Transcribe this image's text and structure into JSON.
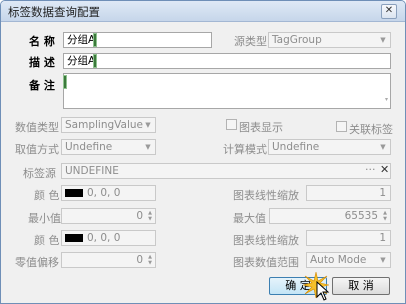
{
  "window": {
    "title": "标签数据查询配置",
    "close_glyph": "✕"
  },
  "form": {
    "name_label": "名 称",
    "name_value": "分组A",
    "source_type_label": "源类型",
    "source_type_value": "TagGroup",
    "desc_label": "描 述",
    "desc_value": "分组A",
    "remark_label": "备 注",
    "remark_value": "",
    "data_type_label": "数值类型",
    "data_type_value": "SamplingValue",
    "chart_display_label": "图表显示",
    "related_tag_label": "关联标签",
    "fetch_mode_label": "取值方式",
    "fetch_mode_value": "Undefine",
    "calc_mode_label": "计算模式",
    "calc_mode_value": "Undefine",
    "tag_source_label": "标签源",
    "tag_source_value": "UNDEFINE",
    "tag_source_more": "···",
    "tag_source_clear": "✕",
    "color1_label": "颜 色",
    "color1_value": "0, 0, 0",
    "chart_line_scale1_label": "图表线性缩放",
    "chart_line_scale1_value": "1",
    "min_label": "最小值",
    "min_value": "0",
    "max_label": "最大值",
    "max_value": "65535",
    "color2_label": "颜 色",
    "color2_value": "0, 0, 0",
    "chart_line_scale2_label": "图表线性缩放",
    "chart_line_scale2_value": "1",
    "zero_offset_label": "零值偏移",
    "zero_offset_value": "0",
    "chart_range_label": "图表数值范围",
    "chart_range_value": "Auto Mode"
  },
  "buttons": {
    "ok": "确 定",
    "cancel": "取 消"
  },
  "colors": {
    "swatch": "#000000",
    "accent": "#3c7fb1"
  }
}
